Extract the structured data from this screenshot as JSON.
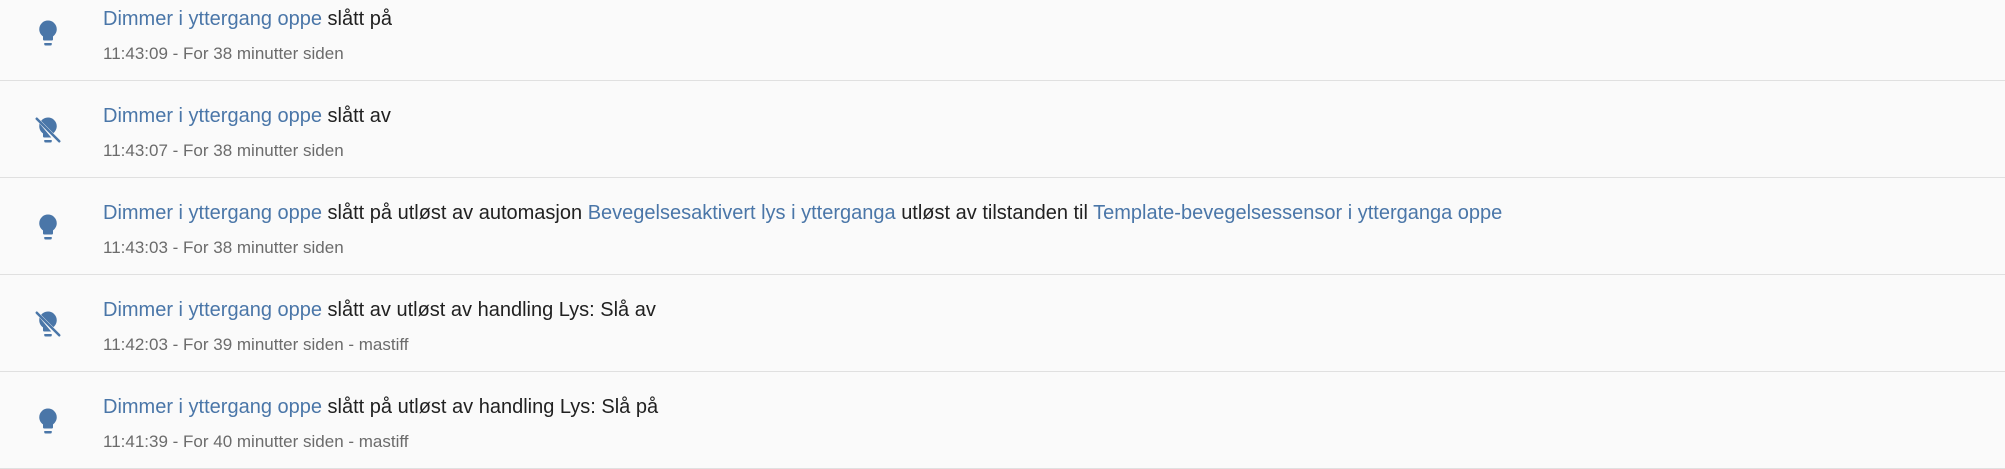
{
  "colors": {
    "link": "#4a76a8",
    "icon": "#4a76a8",
    "text": "#212121",
    "meta": "#6b6b6b",
    "divider": "#e0e0e0",
    "background": "#fafafa"
  },
  "entries": [
    {
      "icon": "lightbulb-icon",
      "entity": "Dimmer i yttergang oppe",
      "action": "slått på",
      "meta": "11:43:09 - For 38 minutter siden"
    },
    {
      "icon": "lightbulb-off-icon",
      "entity": "Dimmer i yttergang oppe",
      "action": "slått av",
      "meta": "11:43:07 - For 38 minutter siden"
    },
    {
      "icon": "lightbulb-icon",
      "entity": "Dimmer i yttergang oppe",
      "action": "slått på utløst av automasjon",
      "automation": "Bevegelsesaktivert lys i ytterganga",
      "mid": "utløst av tilstanden til",
      "sensor": "Template-bevegelsessensor i ytterganga oppe",
      "meta": "11:43:03 - For 38 minutter siden"
    },
    {
      "icon": "lightbulb-off-icon",
      "entity": "Dimmer i yttergang oppe",
      "action": "slått av utløst av handling Lys: Slå av",
      "meta": "11:42:03 - For 39 minutter siden - mastiff"
    },
    {
      "icon": "lightbulb-icon",
      "entity": "Dimmer i yttergang oppe",
      "action": "slått på utløst av handling Lys: Slå på",
      "meta": "11:41:39 - For 40 minutter siden - mastiff"
    }
  ]
}
